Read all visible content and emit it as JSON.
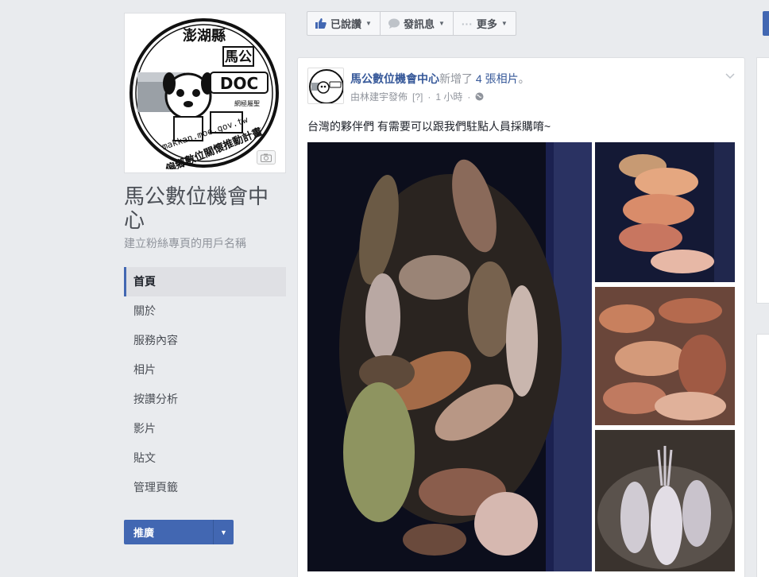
{
  "page": {
    "name": "馬公數位機會中心",
    "username_prompt": "建立粉絲專頁的用戶名稱"
  },
  "profile_logo": {
    "top_text": "澎湖縣",
    "center_text": "馬公",
    "badge_text": "DOC",
    "side_text": "網極屬聖",
    "url_text": "makkan.moe.gov.tw",
    "bottom_text": "偏鄉數位關懷推動計畫"
  },
  "nav": {
    "items": [
      {
        "label": "首頁",
        "active": true
      },
      {
        "label": "關於",
        "active": false
      },
      {
        "label": "服務內容",
        "active": false
      },
      {
        "label": "相片",
        "active": false
      },
      {
        "label": "按讚分析",
        "active": false
      },
      {
        "label": "影片",
        "active": false
      },
      {
        "label": "貼文",
        "active": false
      },
      {
        "label": "管理頁籤",
        "active": false
      }
    ]
  },
  "promote_button": {
    "label": "推廣"
  },
  "action_bar": {
    "liked_label": "已說讚",
    "message_label": "發訊息",
    "more_label": "更多"
  },
  "post": {
    "author": "馬公數位機會中心",
    "action": "新增了",
    "photos_link": "4 張相片",
    "separator": "。",
    "publisher": "由林建宇發佈",
    "help_mark": "[?]",
    "dot": "·",
    "time": "1 小時",
    "text": "台灣的夥伴們 有需要可以跟我們駐點人員採購唷~"
  },
  "colors": {
    "brand_blue": "#4267b2",
    "link_blue": "#365899",
    "background": "#e9ebee"
  },
  "icons": {
    "like": "thumbs-up-icon",
    "message": "chat-bubble-icon",
    "more": "ellipsis-icon",
    "privacy": "globe-icon",
    "camera": "camera-icon",
    "chevron": "chevron-down-icon"
  }
}
